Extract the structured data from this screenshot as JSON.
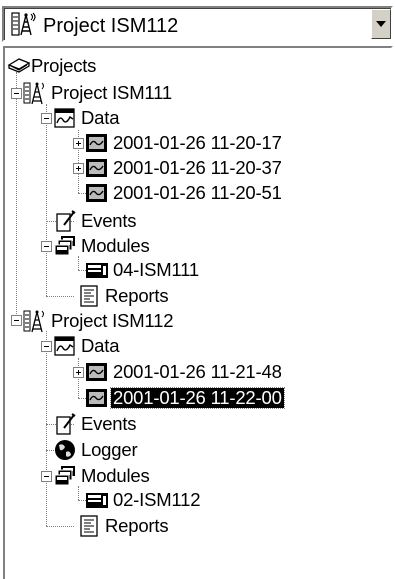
{
  "combo": {
    "selected": "Project ISM112",
    "icon": "antenna-tower-icon",
    "arrow_icon": "chevron-down-icon"
  },
  "tree": {
    "root": {
      "label": "Projects",
      "icon": "projects-book-icon"
    },
    "projects": [
      {
        "label": "Project ISM111",
        "expanded": true,
        "data": {
          "label": "Data",
          "expanded": true,
          "items": [
            "2001-01-26 11-20-17",
            "2001-01-26 11-20-37",
            "2001-01-26 11-20-51"
          ]
        },
        "events": "Events",
        "modules": {
          "label": "Modules",
          "items": [
            "04-ISM111"
          ]
        },
        "reports": "Reports"
      },
      {
        "label": "Project ISM112",
        "expanded": true,
        "data": {
          "label": "Data",
          "expanded": true,
          "items": [
            "2001-01-26 11-21-48",
            "2001-01-26 11-22-00"
          ],
          "selected_item": "2001-01-26 11-22-00"
        },
        "events": "Events",
        "logger": "Logger",
        "modules": {
          "label": "Modules",
          "items": [
            "02-ISM112"
          ]
        },
        "reports": "Reports"
      }
    ]
  }
}
